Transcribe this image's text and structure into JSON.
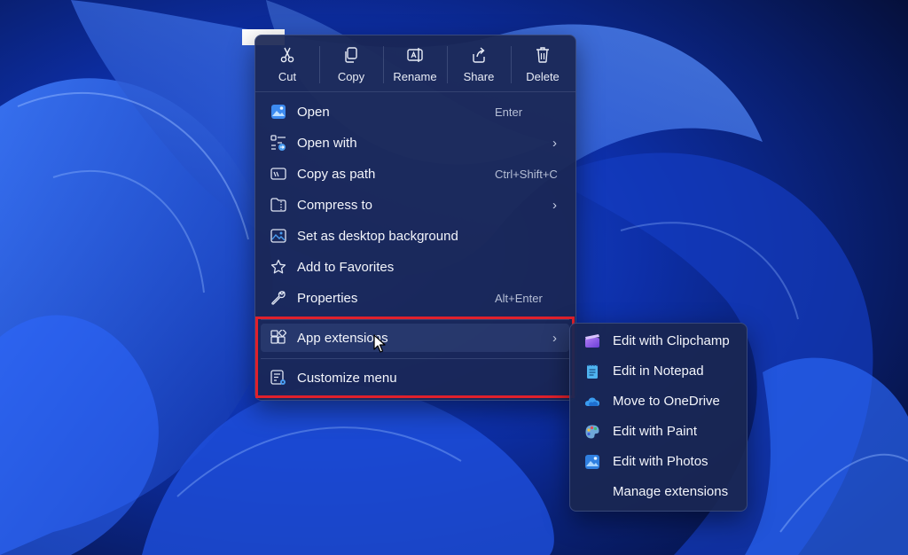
{
  "toolbar": {
    "cut_label": "Cut",
    "copy_label": "Copy",
    "rename_label": "Rename",
    "share_label": "Share",
    "delete_label": "Delete"
  },
  "menu": {
    "items": [
      {
        "label": "Open",
        "shortcut": "Enter",
        "icon": "image-icon"
      },
      {
        "label": "Open with",
        "icon": "open-with-icon",
        "has_submenu": true
      },
      {
        "label": "Copy as path",
        "shortcut": "Ctrl+Shift+C",
        "icon": "copy-path-icon"
      },
      {
        "label": "Compress to",
        "icon": "zip-folder-icon",
        "has_submenu": true
      },
      {
        "label": "Set as desktop background",
        "icon": "desktop-background-icon"
      },
      {
        "label": "Add to Favorites",
        "icon": "star-icon"
      },
      {
        "label": "Properties",
        "shortcut": "Alt+Enter",
        "icon": "wrench-icon"
      },
      {
        "label": "App extensions",
        "icon": "app-extensions-icon",
        "has_submenu": true
      },
      {
        "label": "Customize menu",
        "icon": "customize-menu-icon"
      }
    ]
  },
  "submenu": {
    "items": [
      {
        "label": "Edit with Clipchamp",
        "icon": "clipchamp-icon"
      },
      {
        "label": "Edit in Notepad",
        "icon": "notepad-icon"
      },
      {
        "label": "Move to OneDrive",
        "icon": "onedrive-icon"
      },
      {
        "label": "Edit with Paint",
        "icon": "paint-icon"
      },
      {
        "label": "Edit with Photos",
        "icon": "photos-icon"
      },
      {
        "label": "Manage extensions",
        "icon": ""
      }
    ]
  },
  "colors": {
    "highlight_border": "#e0202c",
    "menu_background": "#1a2652",
    "accent": "#4a9cf0"
  }
}
